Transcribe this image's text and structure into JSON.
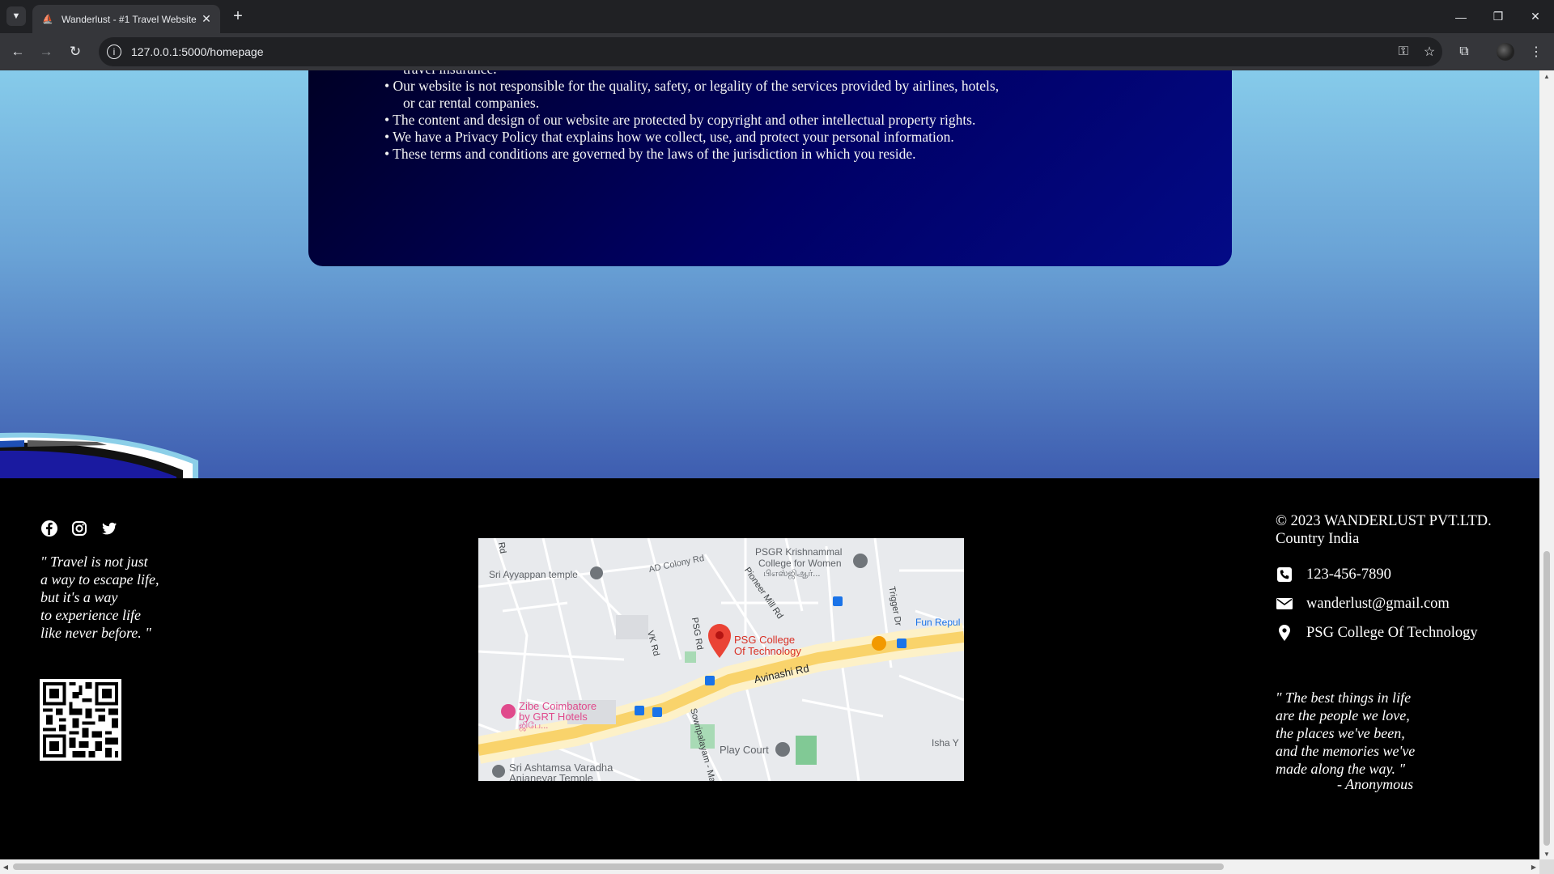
{
  "browser": {
    "tab_title": "Wanderlust - #1 Travel Website",
    "url": "127.0.0.1:5000/homepage"
  },
  "terms": {
    "cut_line": "travel insurance.",
    "items": [
      {
        "line1": "• Our website is not responsible for the quality, safety, or legality of the services provided by airlines, hotels,",
        "line2": "or car rental companies."
      },
      {
        "line1": "• The content and design of our website are protected by copyright and other intellectual property rights."
      },
      {
        "line1": "• We have a Privacy Policy that explains how we collect, use, and protect your personal information."
      },
      {
        "line1": "• These terms and conditions are governed by the laws of the jurisdiction in which you reside."
      }
    ]
  },
  "footer": {
    "social_icons": [
      "facebook-icon",
      "instagram-icon",
      "twitter-icon"
    ],
    "quote_left": [
      "\" Travel is not just",
      "a way to escape life,",
      "but it's a way",
      "to experience life",
      "like never before. \""
    ],
    "map": {
      "labels": {
        "sri_ayyappan": "Sri Ayyappan temple",
        "ad_colony": "AD Colony Rd",
        "psgr_1": "PSGR Krishnammal",
        "psgr_2": "College for Women",
        "psgr_3": "பிஎஸ்ஜிஆர்...",
        "pioneer": "Pioneer Mill Rd",
        "trigger": "Trigger Dr",
        "fun": "Fun Repul",
        "psg_rd": "PSG Rd",
        "vk_rd": "VK Rd",
        "psg_1": "PSG College",
        "psg_2": "Of Technology",
        "avinashi": "Avinashi Rd",
        "zibe_1": "Zibe Coimbatore",
        "zibe_2": "by GRT Hotels",
        "zibe_3": "ஜிபே...",
        "sowripalayam": "Sowripalayam - Ma",
        "play_court": "Play Court",
        "isha": "Isha Y",
        "ashtamsa_1": "Sri Ashtamsa Varadha",
        "ashtamsa_2": "Anjaneyar Temple",
        "rd": "Rd"
      }
    },
    "copyright": "© 2023 WANDERLUST PVT.LTD.",
    "country": "Country India",
    "phone": "123-456-7890",
    "email": "wanderlust@gmail.com",
    "location": "PSG College Of Technology",
    "quote_right": [
      "\" The best things in life",
      "are the people we love,",
      "the places we've been,",
      "and the memories we've",
      "made along the way. \""
    ],
    "author": "- Anonymous"
  }
}
